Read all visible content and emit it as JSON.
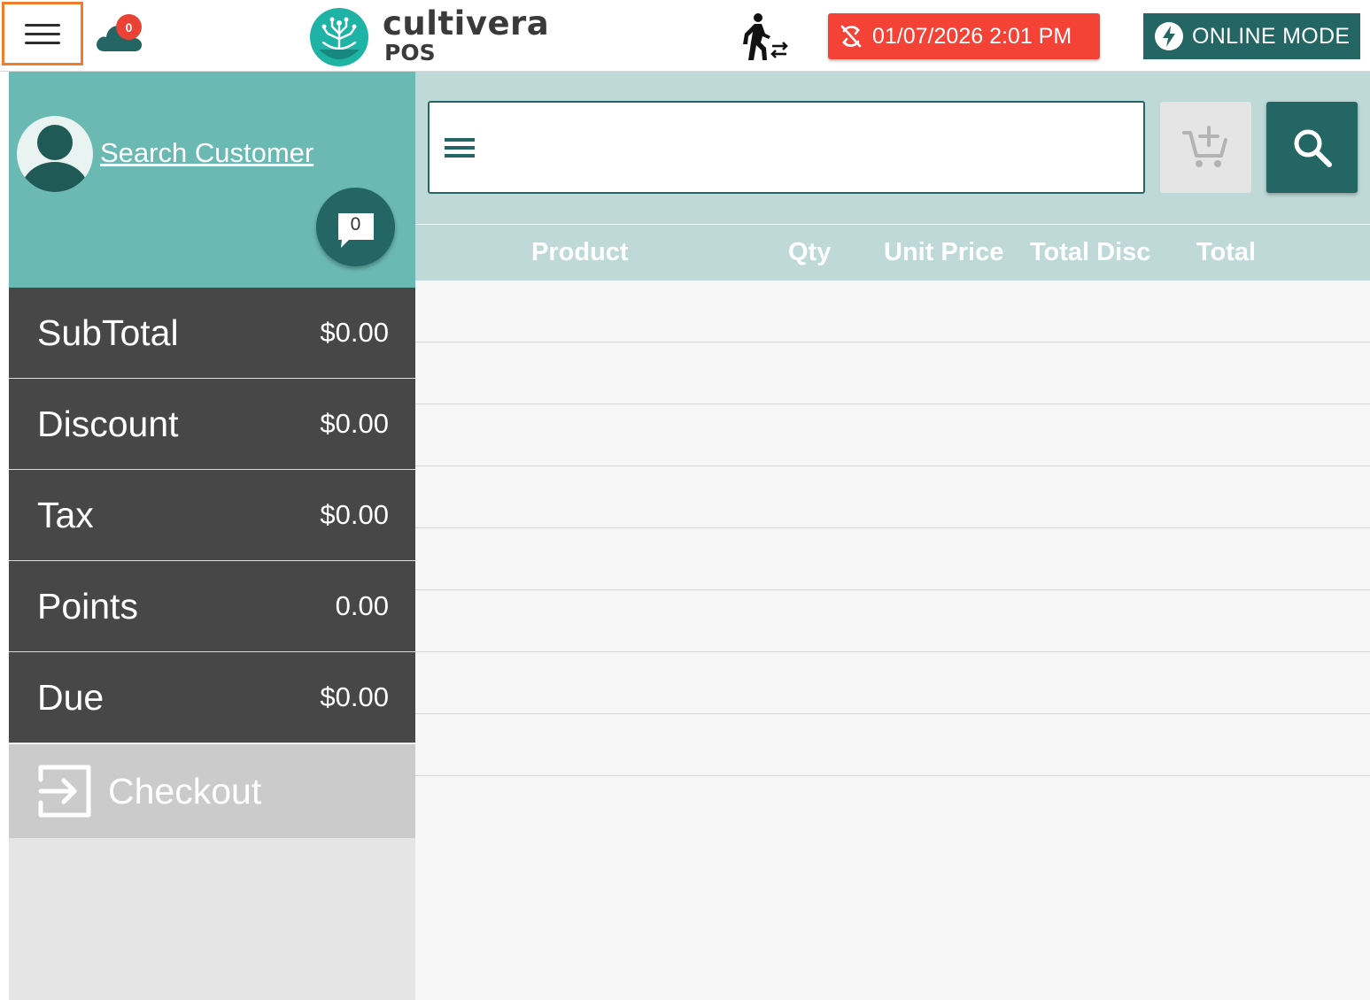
{
  "header": {
    "menu_icon": "hamburger-menu-icon",
    "cloud_icon": "cloud-icon",
    "cloud_badge": "0",
    "logo_icon": "cultivera-logo-icon",
    "brand_name": "cultivera",
    "brand_sub": "POS",
    "walker_icon": "walk-in-customer-icon",
    "sync_icon": "sync-disabled-icon",
    "datetime": "01/07/2026 2:01 PM",
    "mode_icon": "lightning-bolt-icon",
    "mode_label": "ONLINE MODE",
    "colors": {
      "accent": "#236663",
      "alert": "#f44336",
      "highlight": "#f07d2b"
    }
  },
  "customer": {
    "avatar_icon": "user-avatar-icon",
    "search_label": "Search Customer",
    "notes_icon": "chat-bubble-icon",
    "notes_count": "0"
  },
  "summary": {
    "rows": [
      {
        "label": "SubTotal",
        "value": "$0.00"
      },
      {
        "label": "Discount",
        "value": "$0.00"
      },
      {
        "label": "Tax",
        "value": "$0.00"
      },
      {
        "label": "Points",
        "value": "0.00"
      },
      {
        "label": "Due",
        "value": "$0.00"
      }
    ],
    "checkout_icon": "exit-arrow-icon",
    "checkout_label": "Checkout"
  },
  "search": {
    "placeholder": "",
    "value": "",
    "add_to_cart_icon": "add-to-cart-icon",
    "search_icon": "search-icon"
  },
  "table": {
    "columns": [
      "Product",
      "Qty",
      "Unit Price",
      "Total Disc",
      "Total"
    ],
    "rows": []
  }
}
